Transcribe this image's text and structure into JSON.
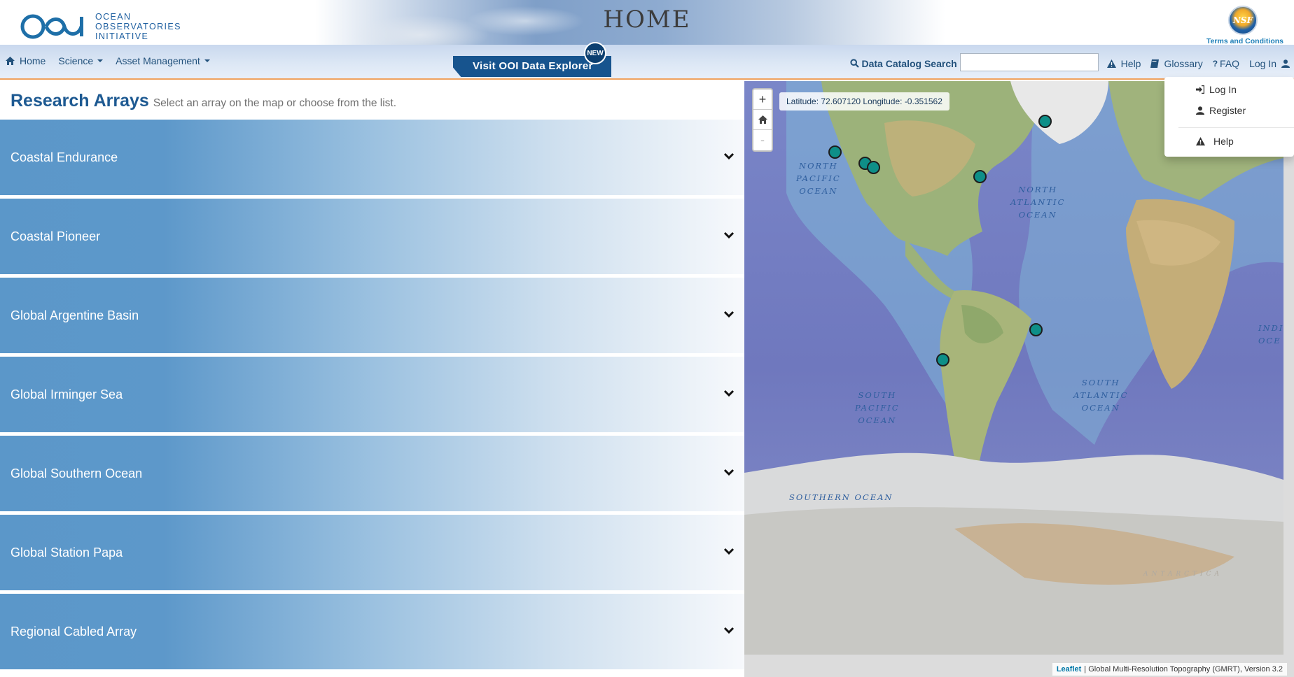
{
  "banner": {
    "logo_lines": [
      "OCEAN",
      "OBSERVATORIES",
      "INITIATIVE"
    ],
    "page_title": "HOME",
    "nsf_badge": "NSF",
    "terms_link": "Terms and Conditions"
  },
  "navbar": {
    "home_label": "Home",
    "science_label": "Science",
    "asset_label": "Asset Management",
    "explorer_label": "Visit OOI Data Explorer",
    "new_badge": "NEW",
    "search_label": "Data Catalog Search",
    "search_value": "",
    "help_label": "Help",
    "glossary_label": "Glossary",
    "faq_label": "FAQ",
    "login_label": "Log In"
  },
  "research": {
    "title": "Research Arrays",
    "subtitle": "Select an array on the map or choose from the list.",
    "arrays": [
      "Coastal Endurance",
      "Coastal Pioneer",
      "Global Argentine Basin",
      "Global Irminger Sea",
      "Global Southern Ocean",
      "Global Station Papa",
      "Regional Cabled Array"
    ]
  },
  "map": {
    "coords": "Latitude: 72.607120 Longitude: -0.351562",
    "zoom_in": "+",
    "zoom_out": "-",
    "ocean_labels": {
      "north_pacific": "NORTH\nPACIFIC\nOCEAN",
      "north_atlantic": "NORTH\nATLANTIC\nOCEAN",
      "south_pacific": "SOUTH\nPACIFIC\nOCEAN",
      "south_atlantic": "SOUTH\nATLANTIC\nOCEAN",
      "southern": "SOUTHERN OCEAN",
      "indian": "INDI\nOCE",
      "antarctica": "ANTARCTICA"
    },
    "attribution_link": "Leaflet",
    "attribution_text": "| Global Multi-Resolution Topography (GMRT), Version 3.2"
  },
  "user_menu": {
    "login": "Log In",
    "register": "Register",
    "help": "Help"
  },
  "colors": {
    "brand_blue": "#1e5a92",
    "marker": "#0e8f88",
    "nav_accent": "#f0a25e"
  }
}
